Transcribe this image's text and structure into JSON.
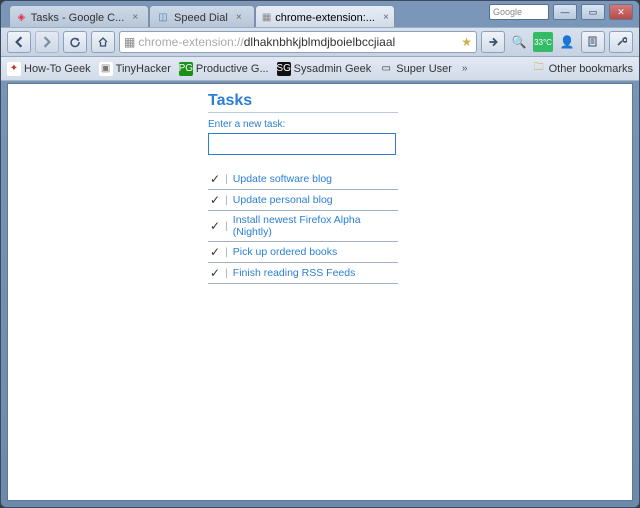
{
  "window": {
    "search_placeholder": "Google",
    "tabs": [
      {
        "label": "Tasks - Google C...",
        "active": false
      },
      {
        "label": "Speed Dial",
        "active": false
      },
      {
        "label": "chrome-extension:...",
        "active": true
      }
    ]
  },
  "toolbar": {
    "url_scheme": "chrome-extension://",
    "url_path": "dlhaknbhkjblmdjboielbccjiaal",
    "weather_badge": "33°C"
  },
  "bookmarks": {
    "items": [
      {
        "label": "How-To Geek"
      },
      {
        "label": "TinyHacker"
      },
      {
        "label": "Productive G..."
      },
      {
        "label": "Sysadmin Geek"
      },
      {
        "label": "Super User"
      }
    ],
    "overflow": "»",
    "other": "Other bookmarks"
  },
  "tasks": {
    "title": "Tasks",
    "enter_label": "Enter a new task:",
    "items": [
      {
        "text": "Update software blog"
      },
      {
        "text": "Update personal blog"
      },
      {
        "text": "Install newest Firefox Alpha (Nightly)"
      },
      {
        "text": "Pick up ordered books"
      },
      {
        "text": "Finish reading RSS Feeds"
      }
    ]
  }
}
